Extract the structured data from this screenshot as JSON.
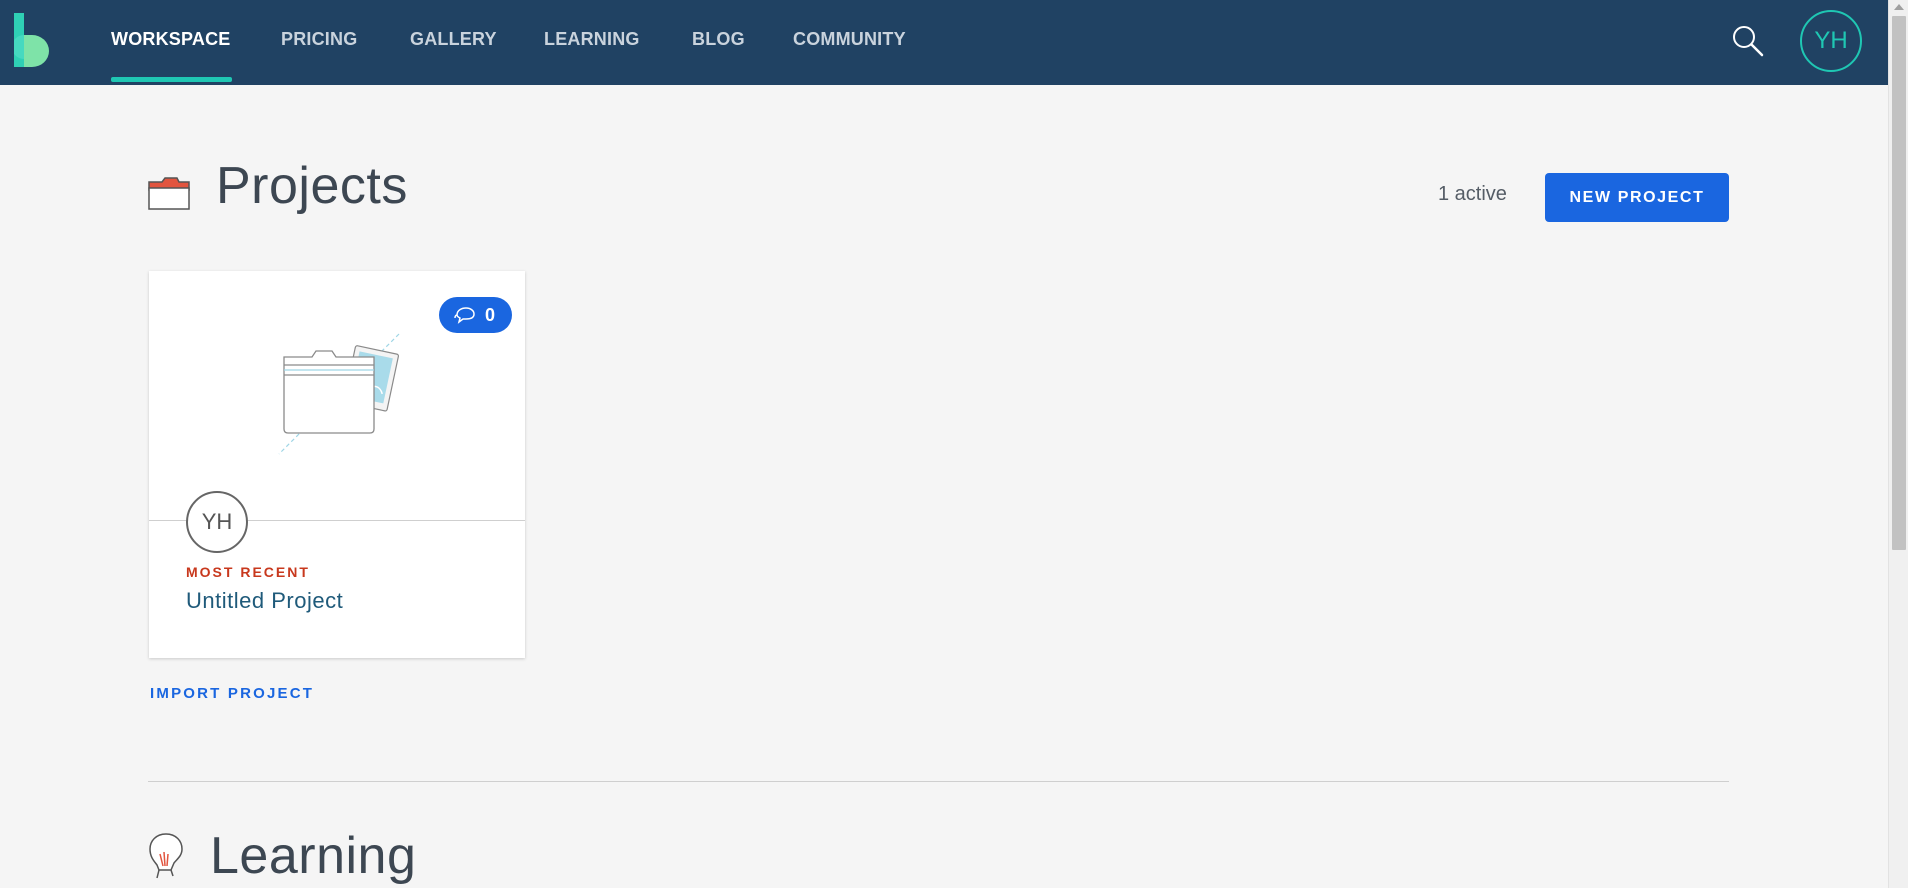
{
  "nav": {
    "items": [
      {
        "label": "WORKSPACE",
        "active": true
      },
      {
        "label": "PRICING",
        "active": false
      },
      {
        "label": "GALLERY",
        "active": false
      },
      {
        "label": "LEARNING",
        "active": false
      },
      {
        "label": "BLOG",
        "active": false
      },
      {
        "label": "COMMUNITY",
        "active": false
      }
    ],
    "search_icon": "search-icon",
    "user_initials": "YH"
  },
  "projects": {
    "title": "Projects",
    "icon": "folder-icon",
    "active_count": "1 active",
    "new_button": "NEW PROJECT",
    "card": {
      "comment_count": "0",
      "owner_initials": "YH",
      "tag": "MOST RECENT",
      "name": "Untitled Project"
    },
    "import_link": "IMPORT PROJECT"
  },
  "learning": {
    "title": "Learning",
    "icon": "lightbulb-icon"
  },
  "colors": {
    "topbar": "#204263",
    "accent": "#1fc7b3",
    "primary": "#1a66e0",
    "tag": "#c8381d"
  }
}
